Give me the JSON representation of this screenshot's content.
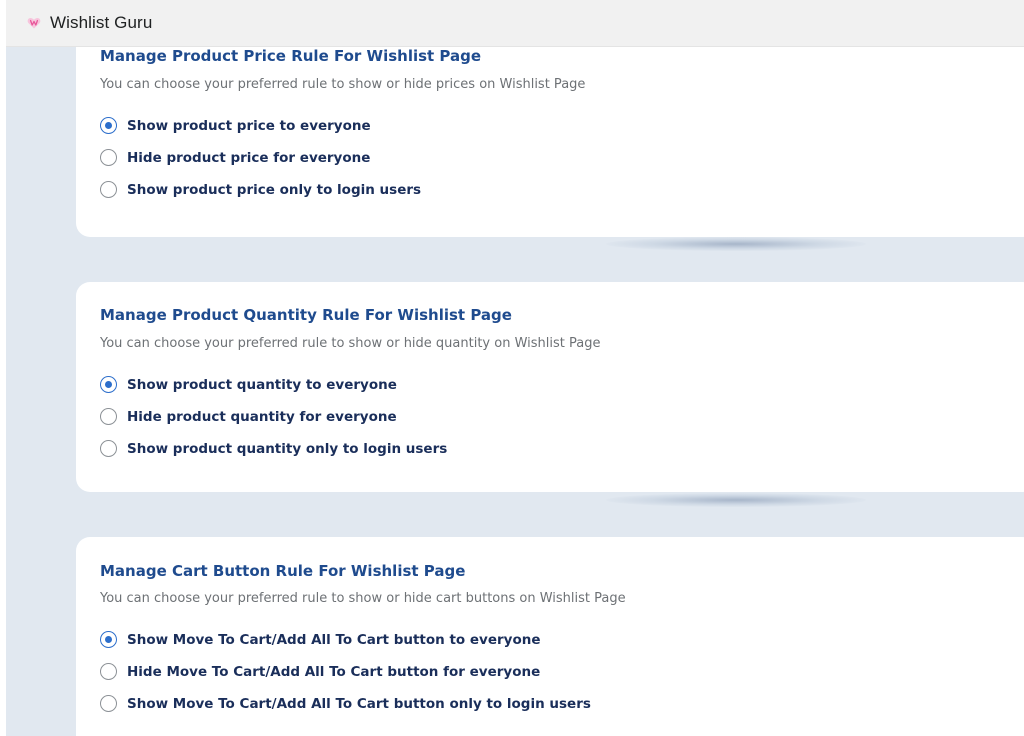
{
  "app": {
    "title": "Wishlist Guru",
    "logo_icon": "wishlist-heart-icon",
    "logo_color": "#e8579a"
  },
  "colors": {
    "accent": "#2c6ecb",
    "title": "#1f4b8e",
    "background": "#e1e8f0"
  },
  "sections": [
    {
      "title": "Manage Product Price Rule For Wishlist Page",
      "description": "You can choose your preferred rule to show or hide prices on Wishlist Page",
      "options": [
        {
          "label": "Show product price to everyone",
          "selected": true
        },
        {
          "label": "Hide product price for everyone",
          "selected": false
        },
        {
          "label": "Show product price only to login users",
          "selected": false
        }
      ]
    },
    {
      "title": "Manage Product Quantity Rule For Wishlist Page",
      "description": "You can choose your preferred rule to show or hide quantity on Wishlist Page",
      "options": [
        {
          "label": "Show product quantity to everyone",
          "selected": true
        },
        {
          "label": "Hide product quantity for everyone",
          "selected": false
        },
        {
          "label": "Show product quantity only to login users",
          "selected": false
        }
      ]
    },
    {
      "title": "Manage Cart Button Rule For Wishlist Page",
      "description": "You can choose your preferred rule to show or hide cart buttons on Wishlist Page",
      "options": [
        {
          "label": "Show Move To Cart/Add All To Cart button to everyone",
          "selected": true
        },
        {
          "label": "Hide Move To Cart/Add All To Cart button for everyone",
          "selected": false
        },
        {
          "label": "Show Move To Cart/Add All To Cart button only to login users",
          "selected": false
        }
      ]
    }
  ]
}
